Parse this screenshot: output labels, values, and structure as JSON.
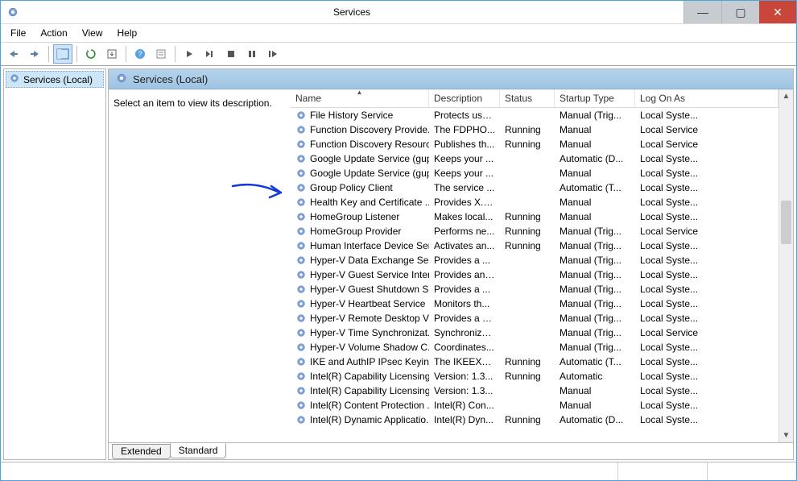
{
  "window": {
    "title": "Services"
  },
  "menu": {
    "file": "File",
    "action": "Action",
    "view": "View",
    "help": "Help"
  },
  "tree": {
    "root": "Services (Local)"
  },
  "pane": {
    "title": "Services (Local)",
    "hint": "Select an item to view its description."
  },
  "columns": {
    "name": "Name",
    "description": "Description",
    "status": "Status",
    "startup": "Startup Type",
    "logon": "Log On As"
  },
  "tabs": {
    "extended": "Extended",
    "standard": "Standard"
  },
  "services": [
    {
      "name": "File History Service",
      "desc": "Protects use...",
      "status": "",
      "startup": "Manual (Trig...",
      "logon": "Local Syste..."
    },
    {
      "name": "Function Discovery Provide...",
      "desc": "The FDPHO...",
      "status": "Running",
      "startup": "Manual",
      "logon": "Local Service"
    },
    {
      "name": "Function Discovery Resourc...",
      "desc": "Publishes th...",
      "status": "Running",
      "startup": "Manual",
      "logon": "Local Service"
    },
    {
      "name": "Google Update Service (gup...",
      "desc": "Keeps your ...",
      "status": "",
      "startup": "Automatic (D...",
      "logon": "Local Syste..."
    },
    {
      "name": "Google Update Service (gup...",
      "desc": "Keeps your ...",
      "status": "",
      "startup": "Manual",
      "logon": "Local Syste..."
    },
    {
      "name": "Group Policy Client",
      "desc": "The service ...",
      "status": "",
      "startup": "Automatic (T...",
      "logon": "Local Syste..."
    },
    {
      "name": "Health Key and Certificate ...",
      "desc": "Provides X.5...",
      "status": "",
      "startup": "Manual",
      "logon": "Local Syste..."
    },
    {
      "name": "HomeGroup Listener",
      "desc": "Makes local...",
      "status": "Running",
      "startup": "Manual",
      "logon": "Local Syste..."
    },
    {
      "name": "HomeGroup Provider",
      "desc": "Performs ne...",
      "status": "Running",
      "startup": "Manual (Trig...",
      "logon": "Local Service"
    },
    {
      "name": "Human Interface Device Ser...",
      "desc": "Activates an...",
      "status": "Running",
      "startup": "Manual (Trig...",
      "logon": "Local Syste..."
    },
    {
      "name": "Hyper-V Data Exchange Ser...",
      "desc": "Provides a ...",
      "status": "",
      "startup": "Manual (Trig...",
      "logon": "Local Syste..."
    },
    {
      "name": "Hyper-V Guest Service Inter...",
      "desc": "Provides an ...",
      "status": "",
      "startup": "Manual (Trig...",
      "logon": "Local Syste..."
    },
    {
      "name": "Hyper-V Guest Shutdown S...",
      "desc": "Provides a ...",
      "status": "",
      "startup": "Manual (Trig...",
      "logon": "Local Syste..."
    },
    {
      "name": "Hyper-V Heartbeat Service",
      "desc": "Monitors th...",
      "status": "",
      "startup": "Manual (Trig...",
      "logon": "Local Syste..."
    },
    {
      "name": "Hyper-V Remote Desktop Vi...",
      "desc": "Provides a p...",
      "status": "",
      "startup": "Manual (Trig...",
      "logon": "Local Syste..."
    },
    {
      "name": "Hyper-V Time Synchronizat...",
      "desc": "Synchronize...",
      "status": "",
      "startup": "Manual (Trig...",
      "logon": "Local Service"
    },
    {
      "name": "Hyper-V Volume Shadow C...",
      "desc": "Coordinates...",
      "status": "",
      "startup": "Manual (Trig...",
      "logon": "Local Syste..."
    },
    {
      "name": "IKE and AuthIP IPsec Keying...",
      "desc": "The IKEEXT ...",
      "status": "Running",
      "startup": "Automatic (T...",
      "logon": "Local Syste..."
    },
    {
      "name": "Intel(R) Capability Licensing...",
      "desc": "Version: 1.3...",
      "status": "Running",
      "startup": "Automatic",
      "logon": "Local Syste..."
    },
    {
      "name": "Intel(R) Capability Licensing...",
      "desc": "Version: 1.3...",
      "status": "",
      "startup": "Manual",
      "logon": "Local Syste..."
    },
    {
      "name": "Intel(R) Content Protection ...",
      "desc": "Intel(R) Con...",
      "status": "",
      "startup": "Manual",
      "logon": "Local Syste..."
    },
    {
      "name": "Intel(R) Dynamic Applicatio...",
      "desc": "Intel(R) Dyn...",
      "status": "Running",
      "startup": "Automatic (D...",
      "logon": "Local Syste..."
    }
  ]
}
